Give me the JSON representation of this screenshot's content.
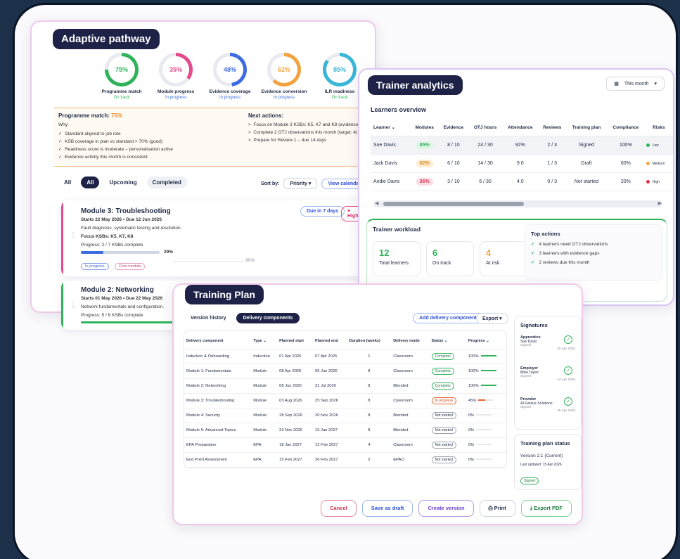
{
  "adaptive": {
    "title": "Adaptive pathway",
    "rings": [
      {
        "pct": "75%",
        "label": "Programme match",
        "status": "On track",
        "color": "#2fb35a",
        "value": 0.75
      },
      {
        "pct": "35%",
        "label": "Module progress",
        "status": "In progress",
        "color": "#e54a8c",
        "value": 0.35
      },
      {
        "pct": "48%",
        "label": "Evidence coverage",
        "status": "In progress",
        "color": "#3d6be0",
        "value": 0.48
      },
      {
        "pct": "62%",
        "label": "Evidence conversion",
        "status": "In progress",
        "color": "#f2a341",
        "value": 0.62
      },
      {
        "pct": "85%",
        "label": "ILR readiness",
        "status": "On track",
        "color": "#39b6d8",
        "value": 0.85
      }
    ],
    "match_label": "Programme match:",
    "match_value": "75%",
    "why_label": "Why:",
    "why": [
      "Standard aligned to job role",
      "KSB coverage in plan vs standard > 70% (good)",
      "Readiness score is moderate – personalisation active",
      "Evidence activity this month is consistent"
    ],
    "next_label": "Next actions:",
    "next": [
      "Focus on Module 3 KSBs: K5, K7 and K8 (evidence gap)",
      "Complete 2 OTJ observations this month (target: 4)",
      "Prepare for Review 1 – due 14 days"
    ],
    "tabs": [
      "All",
      "All",
      "Upcoming",
      "Completed"
    ],
    "sort_label": "Sort by:",
    "sort_value": "Priority",
    "calendar": "View calendar",
    "modules": [
      {
        "title": "Module 3: Troubleshooting",
        "dates": "Starts 22 May 2026 • Due 12 Jun 2026",
        "desc": "Fault diagnosis, systematic testing and resolution.",
        "ksbs": "Focus KSBs: K5, K7, K8",
        "progress_text": "Progress: 2 / 7 KSBs complete",
        "pct": "29%",
        "pct2": "90%",
        "value": 0.29,
        "due": "Due in 7 days",
        "priority": "High",
        "tag1": "In progress",
        "tag2": "Core module"
      },
      {
        "title": "Module 2: Networking",
        "dates": "Starts 01 May 2026 • Due 22 May 2026",
        "desc": "Network fundamentals and configuration.",
        "progress_text": "Progress: 5 / 6 KSBs complete",
        "value": 0.83
      }
    ]
  },
  "analytics": {
    "title": "Trainer analytics",
    "month": "This month",
    "overview_title": "Learners overview",
    "columns": [
      "Learner",
      "Modules",
      "Evidence",
      "OTJ hours",
      "Attendance",
      "Reviews",
      "Training plan",
      "Compliance",
      "Risks"
    ],
    "rows": [
      {
        "name": "Sue Davis",
        "modules": "85%",
        "evidence": "8 / 10",
        "otj": "24 / 30",
        "attendance": "92%",
        "reviews": "2 / 3",
        "plan": "Signed",
        "compliance": "100%",
        "risk": "Low",
        "mod_color": "#2fb35a",
        "mod_bg": "#dff5e5",
        "risk_color": "#2fb35a"
      },
      {
        "name": "Jack Davis",
        "modules": "62%",
        "evidence": "6 / 10",
        "otj": "14 / 30",
        "attendance": "9.0",
        "reviews": "1 / 3",
        "plan": "Draft",
        "compliance": "60%",
        "risk": "Medium",
        "mod_color": "#e08a1e",
        "mod_bg": "#fdebd2",
        "risk_color": "#f2a341"
      },
      {
        "name": "Andie Davis",
        "modules": "36%",
        "evidence": "3 / 10",
        "otj": "6 / 30",
        "attendance": "4.0",
        "reviews": "0 / 3",
        "plan": "Not started",
        "compliance": "20%",
        "risk": "High",
        "mod_color": "#d83a5a",
        "mod_bg": "#fbdde4",
        "risk_color": "#e0334d"
      }
    ],
    "workload_title": "Trainer workload",
    "stats": [
      {
        "n": "12",
        "label": "Total learners",
        "color": "#2fb35a"
      },
      {
        "n": "6",
        "label": "On track",
        "color": "#2fb35a"
      },
      {
        "n": "4",
        "label": "At risk",
        "color": "#f2a341"
      }
    ],
    "top_actions_title": "Top actions",
    "top_actions": [
      "4 learners need OTJ observations",
      "3 learners with evidence gaps",
      "2 reviews due this month"
    ]
  },
  "plan": {
    "title": "Training Plan",
    "tabs": [
      "Version history",
      "Delivery components"
    ],
    "add": "Add delivery component",
    "export": "Export",
    "columns": [
      "Delivery component",
      "Type",
      "Planned start",
      "Planned end",
      "Duration (weeks)",
      "Delivery mode",
      "Status",
      "Progress"
    ],
    "rows": [
      {
        "c": "Induction & Onboarding",
        "t": "Induction",
        "s": "01 Apr 2026",
        "e": "07 Apr 2026",
        "d": "1",
        "m": "Classroom",
        "st": "Complete",
        "p": "100%",
        "v": 1.0,
        "cls": "complete"
      },
      {
        "c": "Module 1: Fundamentals",
        "t": "Module",
        "s": "08 Apr 2026",
        "e": "05 Jun 2026",
        "d": "8",
        "m": "Classroom",
        "st": "Complete",
        "p": "100%",
        "v": 1.0,
        "cls": "complete"
      },
      {
        "c": "Module 2: Networking",
        "t": "Module",
        "s": "08 Jun 2026",
        "e": "31 Jul 2026",
        "d": "8",
        "m": "Blended",
        "st": "Complete",
        "p": "100%",
        "v": 1.0,
        "cls": "complete"
      },
      {
        "c": "Module 3: Troubleshooting",
        "t": "Module",
        "s": "03 Aug 2026",
        "e": "25 Sep 2026",
        "d": "8",
        "m": "Classroom",
        "st": "In progress",
        "p": "45%",
        "v": 0.45,
        "cls": "inprogress"
      },
      {
        "c": "Module 4: Security",
        "t": "Module",
        "s": "28 Sep 2026",
        "e": "20 Nov 2026",
        "d": "8",
        "m": "Blended",
        "st": "Not started",
        "p": "0%",
        "v": 0,
        "cls": ""
      },
      {
        "c": "Module 5: Advanced Topics",
        "t": "Module",
        "s": "23 Nov 2026",
        "e": "15 Jan 2027",
        "d": "8",
        "m": "Blended",
        "st": "Not started",
        "p": "0%",
        "v": 0,
        "cls": ""
      },
      {
        "c": "EPA Preparation",
        "t": "EPA",
        "s": "18 Jan 2027",
        "e": "12 Feb 2027",
        "d": "4",
        "m": "Classroom",
        "st": "Not started",
        "p": "0%",
        "v": 0,
        "cls": ""
      },
      {
        "c": "End Point Assessment",
        "t": "EPA",
        "s": "15 Feb 2027",
        "e": "26 Feb 2027",
        "d": "2",
        "m": "EPAO",
        "st": "Not started",
        "p": "0%",
        "v": 0,
        "cls": ""
      }
    ],
    "signatures_title": "Signatures",
    "signatures": [
      {
        "role": "Apprentice",
        "name": "Sue Davis",
        "state": "Signed",
        "date": "15 Apr 2026"
      },
      {
        "role": "Employer",
        "name": "Mike Taylor",
        "state": "Signed",
        "date": "14 Apr 2026"
      },
      {
        "role": "Provider",
        "name": "AI Genius Solutions",
        "state": "Signed",
        "date": "15 Apr 2026"
      }
    ],
    "status_title": "Training plan status",
    "version": "Version 2.1 (Current)",
    "updated": "Last updated: 15 Apr 2026",
    "signed": "Signed",
    "buttons": {
      "cancel": "Cancel",
      "draft": "Save as draft",
      "create": "Create version",
      "print": "Print",
      "pdf": "Export PDF"
    }
  }
}
